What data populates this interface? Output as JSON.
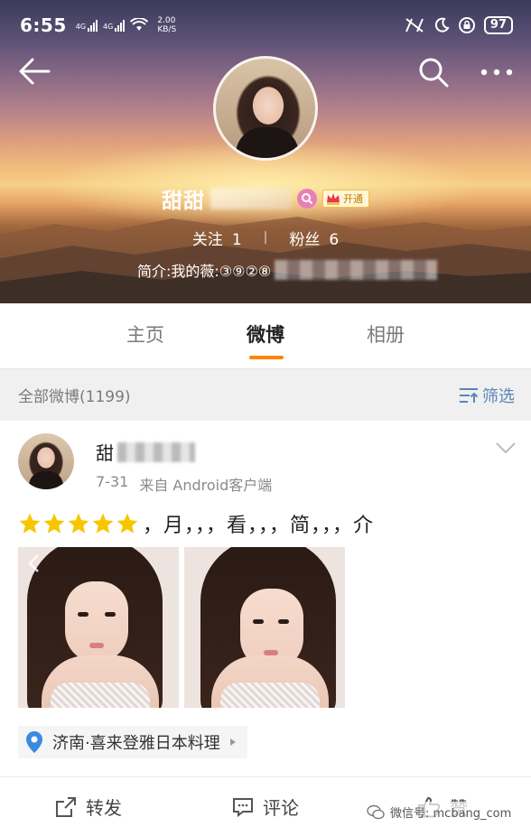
{
  "status_bar": {
    "time": "6:55",
    "net1": "4G",
    "net2": "4G",
    "speed_value": "2.00",
    "speed_unit": "KB/S",
    "battery": "97"
  },
  "profile": {
    "name": "甜甜",
    "vip_label": "开通",
    "follow_label": "关注",
    "follow_count": "1",
    "fans_label": "粉丝",
    "fans_count": "6",
    "bio": "简介:我的薇:③⑨②⑧"
  },
  "tabs": [
    {
      "label": "主页"
    },
    {
      "label": "微博"
    },
    {
      "label": "相册"
    }
  ],
  "filter": {
    "count_label": "全部微博(1199)",
    "filter_label": "筛选"
  },
  "post": {
    "user_name": "甜",
    "date": "7-31",
    "source": "来自 Android客户端",
    "stars": 5,
    "text": "，月，，，看，，，简，，，介",
    "location": "济南·喜来登雅日本料理",
    "actions": {
      "repost": "转发",
      "comment": "评论",
      "like": "赞"
    }
  },
  "watermark": "微信号: mcbang_com",
  "colors": {
    "accent": "#ff8200",
    "link": "#5b84b6",
    "star": "#f7c600"
  }
}
